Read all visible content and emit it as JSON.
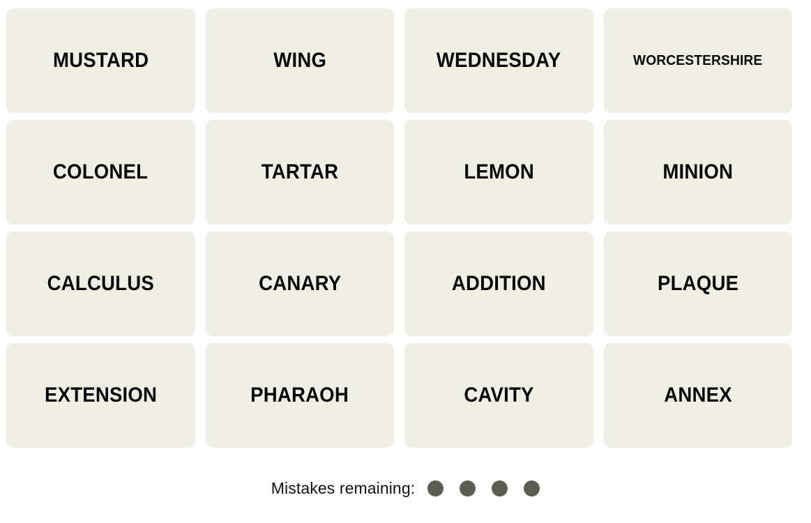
{
  "board": {
    "columns": 4,
    "rows": 4,
    "tile_color": "#efefe6",
    "tile_text_color": "#080808",
    "background_color": "#ffffff",
    "tiles": [
      {
        "label": "MUSTARD",
        "size": "normal"
      },
      {
        "label": "WING",
        "size": "normal"
      },
      {
        "label": "WEDNESDAY",
        "size": "normal"
      },
      {
        "label": "WORCESTERSHIRE",
        "size": "small"
      },
      {
        "label": "COLONEL",
        "size": "normal"
      },
      {
        "label": "TARTAR",
        "size": "normal"
      },
      {
        "label": "LEMON",
        "size": "normal"
      },
      {
        "label": "MINION",
        "size": "normal"
      },
      {
        "label": "CALCULUS",
        "size": "normal"
      },
      {
        "label": "CANARY",
        "size": "normal"
      },
      {
        "label": "ADDITION",
        "size": "normal"
      },
      {
        "label": "PLAQUE",
        "size": "normal"
      },
      {
        "label": "EXTENSION",
        "size": "normal"
      },
      {
        "label": "PHARAOH",
        "size": "normal"
      },
      {
        "label": "CAVITY",
        "size": "normal"
      },
      {
        "label": "ANNEX",
        "size": "normal"
      }
    ]
  },
  "mistakes": {
    "label": "Mistakes remaining:",
    "remaining": 4,
    "dot_color": "#5a5d51",
    "dots": [
      {
        "state": "remaining"
      },
      {
        "state": "remaining"
      },
      {
        "state": "remaining"
      },
      {
        "state": "remaining"
      }
    ]
  }
}
